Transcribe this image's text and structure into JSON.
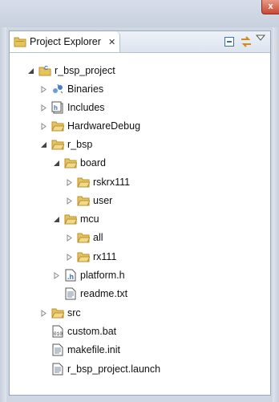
{
  "window": {
    "close_glyph": "x"
  },
  "view": {
    "title": "Project Explorer",
    "close_glyph": "✕",
    "toolbar_icons": [
      "view-icon",
      "collapse-all-icon",
      "link-with-editor-icon",
      "view-menu-icon"
    ]
  },
  "tree": {
    "items": [
      {
        "label": "r_bsp_project",
        "icon": "project-folder-icon",
        "twisty": "expanded"
      },
      {
        "label": "Binaries",
        "icon": "binaries-icon",
        "twisty": "collapsed"
      },
      {
        "label": "Includes",
        "icon": "includes-icon",
        "twisty": "collapsed"
      },
      {
        "label": "HardwareDebug",
        "icon": "folder-icon",
        "twisty": "collapsed"
      },
      {
        "label": "r_bsp",
        "icon": "folder-icon",
        "twisty": "expanded"
      },
      {
        "label": "board",
        "icon": "folder-icon",
        "twisty": "expanded"
      },
      {
        "label": "rskrx111",
        "icon": "folder-icon",
        "twisty": "collapsed"
      },
      {
        "label": "user",
        "icon": "folder-icon",
        "twisty": "collapsed"
      },
      {
        "label": "mcu",
        "icon": "folder-icon",
        "twisty": "expanded"
      },
      {
        "label": "all",
        "icon": "folder-icon",
        "twisty": "collapsed"
      },
      {
        "label": "rx111",
        "icon": "folder-icon",
        "twisty": "collapsed"
      },
      {
        "label": "platform.h",
        "icon": "header-file-icon",
        "twisty": "collapsed"
      },
      {
        "label": "readme.txt",
        "icon": "text-file-icon",
        "twisty": "none"
      },
      {
        "label": "src",
        "icon": "folder-icon",
        "twisty": "collapsed"
      },
      {
        "label": "custom.bat",
        "icon": "binary-file-icon",
        "twisty": "none"
      },
      {
        "label": "makefile.init",
        "icon": "text-file-icon",
        "twisty": "none"
      },
      {
        "label": "r_bsp_project.launch",
        "icon": "text-file-icon",
        "twisty": "none"
      }
    ]
  },
  "colors": {
    "folder": "#e8c35a",
    "folder_dark": "#b8912d",
    "accent": "#3a6fb4"
  }
}
